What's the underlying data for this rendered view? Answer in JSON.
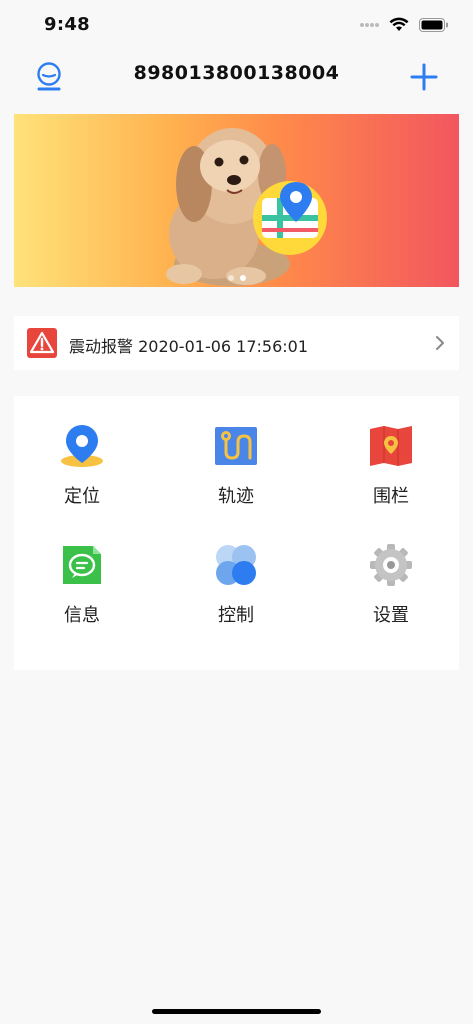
{
  "status_bar": {
    "time": "9:48"
  },
  "nav": {
    "title": "898013800138004"
  },
  "banner": {
    "slides": 2,
    "active_slide": 2
  },
  "alert": {
    "text": "震动报警 2020-01-06 17:56:01"
  },
  "menu": {
    "location": "定位",
    "track": "轨迹",
    "fence": "围栏",
    "message": "信息",
    "control": "控制",
    "settings": "设置"
  },
  "colors": {
    "accent": "#2d7cf0",
    "alert_red": "#e8453c",
    "message_green": "#3bc14a"
  }
}
